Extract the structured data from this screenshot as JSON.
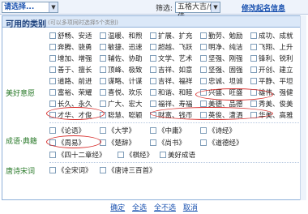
{
  "toolbar": {
    "prompt_select": "请选择...",
    "filter_label": "筛选:",
    "filter_select": "五格大吉/佳佳",
    "modify_link": "修改起名信息"
  },
  "panel": {
    "title": "可用的类别",
    "note": "(可以多项同时选择5个类别)"
  },
  "categories": [
    {
      "label": "美好意愿",
      "rows": [
        [
          "舒畅、安适",
          "温暖、和煦",
          "扩展、扩充",
          "勤劳、勉励",
          "成功、成就"
        ],
        [
          "奔腾、骁勇",
          "敏捷、迅速",
          "超越、飞跃",
          "明净、纯洁",
          "飞翔、上升"
        ],
        [
          "增加、增强",
          "辅佐、协助",
          "文学、艺术",
          "坚强、刚强",
          "锋利、锐利"
        ],
        [
          "善于、擅长",
          "顶峰、极致",
          "吉祥、如意",
          "坚强、固强",
          "开创、建立"
        ],
        [
          "道路、前进",
          "谋略、计谋",
          "吉祥、福祥",
          "忠诚、坦诚",
          "平静、平坦"
        ],
        [
          "富裕、荣耀",
          "喜悦、欢乐",
          "和谐、和睦",
          "兴盛、旺盛",
          "雄伟、强健"
        ],
        [
          "长久、永久",
          "广大、宏大",
          "福祥、寿福",
          "美德、品德",
          "秀美、俊美"
        ],
        [
          "才华、才俊",
          "聪慧、聪颖",
          "财富、钱币",
          "英俊、潇洒",
          "华美、高雅"
        ]
      ]
    },
    {
      "label": "成语·典籍",
      "rows": [
        [
          "《论语》",
          "《大学》",
          "《中庸》",
          "《诗经》"
        ],
        [
          "《周易》",
          "《楚辞》",
          "《尚书》",
          "《道德经》"
        ],
        [
          "《四十二章经》",
          "《棋经》",
          "美好成语"
        ]
      ]
    },
    {
      "label": "唐诗宋词",
      "rows": [
        [
          "《全宋词》",
          "《唐诗三百首》"
        ]
      ]
    }
  ],
  "footer": {
    "confirm": "确定",
    "select_all": "全选",
    "select_none": "全不选",
    "cancel": "取消"
  }
}
